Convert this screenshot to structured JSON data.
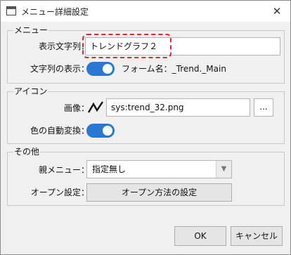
{
  "window": {
    "title": "メニュー詳細設定",
    "close_glyph": "✕"
  },
  "menu_group": {
    "legend": "メニュー",
    "display_text_label": "表示文字列：",
    "display_text_value": "トレンドグラフ２",
    "string_display_label": "文字列の表示：",
    "string_display_on": true,
    "form_name_text": "フォーム名：_Trend._Main"
  },
  "icon_group": {
    "legend": "アイコン",
    "image_label": "画像：",
    "image_icon": "trend-line-icon",
    "image_value": "sys:trend_32.png",
    "browse_label": "...",
    "auto_color_label": "色の自動変換：",
    "auto_color_on": true
  },
  "other_group": {
    "legend": "その他",
    "parent_menu_label": "親メニュー：",
    "parent_menu_value": "指定無し",
    "open_setting_label": "オープン設定：",
    "open_method_button": "オープン方法の設定"
  },
  "footer": {
    "ok_label": "OK",
    "cancel_label": "キャンセル"
  },
  "colors": {
    "toggle_on": "#2b78d4",
    "highlight": "#e0282e"
  }
}
